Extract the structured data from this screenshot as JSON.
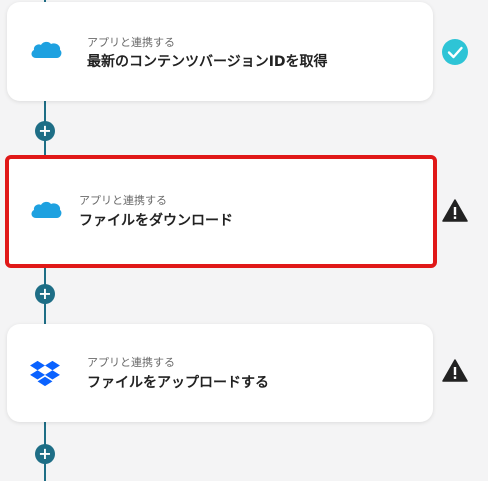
{
  "steps": [
    {
      "subtitle": "アプリと連携する",
      "title": "最新のコンテンツバージョンIDを取得",
      "app_icon": "salesforce-icon",
      "status": "check-icon"
    },
    {
      "subtitle": "アプリと連携する",
      "title": "ファイルをダウンロード",
      "app_icon": "salesforce-icon",
      "status": "warning-icon"
    },
    {
      "subtitle": "アプリと連携する",
      "title": "ファイルをアップロードする",
      "app_icon": "dropbox-icon",
      "status": "warning-icon"
    }
  ],
  "add_step_label": "+",
  "colors": {
    "connector": "#1e6e86",
    "check": "#2ec4d6",
    "warning": "#222222",
    "selected_outline": "#e01818",
    "salesforce": "#1ea1e0",
    "dropbox": "#0a62ff"
  }
}
